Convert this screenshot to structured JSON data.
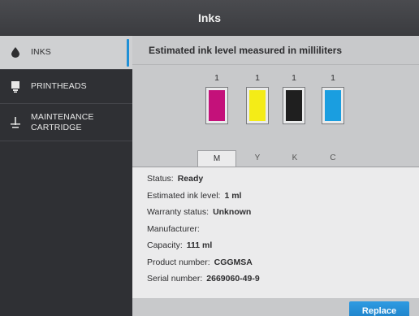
{
  "window": {
    "title": "Inks"
  },
  "sidebar": {
    "items": [
      {
        "label": "INKS",
        "icon": "ink-drop-icon",
        "active": true
      },
      {
        "label": "PRINTHEADS",
        "icon": "printhead-icon",
        "active": false
      },
      {
        "label": "MAINTENANCE",
        "label2": "CARTRIDGE",
        "icon": "maintenance-cartridge-icon",
        "active": false
      }
    ]
  },
  "main": {
    "heading": "Estimated ink level measured in milliliters",
    "cartridges": [
      {
        "tab": "M",
        "level": "1",
        "color": "#c4117a"
      },
      {
        "tab": "Y",
        "level": "1",
        "color": "#f4ec17"
      },
      {
        "tab": "K",
        "level": "1",
        "color": "#1f1f1f"
      },
      {
        "tab": "C",
        "level": "1",
        "color": "#1a9ee0"
      }
    ],
    "details": {
      "status_label": "Status:",
      "status_value": "Ready",
      "level_label": "Estimated ink level:",
      "level_value": "1 ml",
      "warranty_label": "Warranty status:",
      "warranty_value": "Unknown",
      "manufacturer_label": "Manufacturer:",
      "manufacturer_value": "",
      "capacity_label": "Capacity:",
      "capacity_value": "111 ml",
      "product_label": "Product number:",
      "product_value": "CGGMSA",
      "serial_label": "Serial number:",
      "serial_value": "2669060-49-9"
    },
    "replace_label": "Replace"
  },
  "colors": {
    "accent": "#1e8fd6"
  }
}
